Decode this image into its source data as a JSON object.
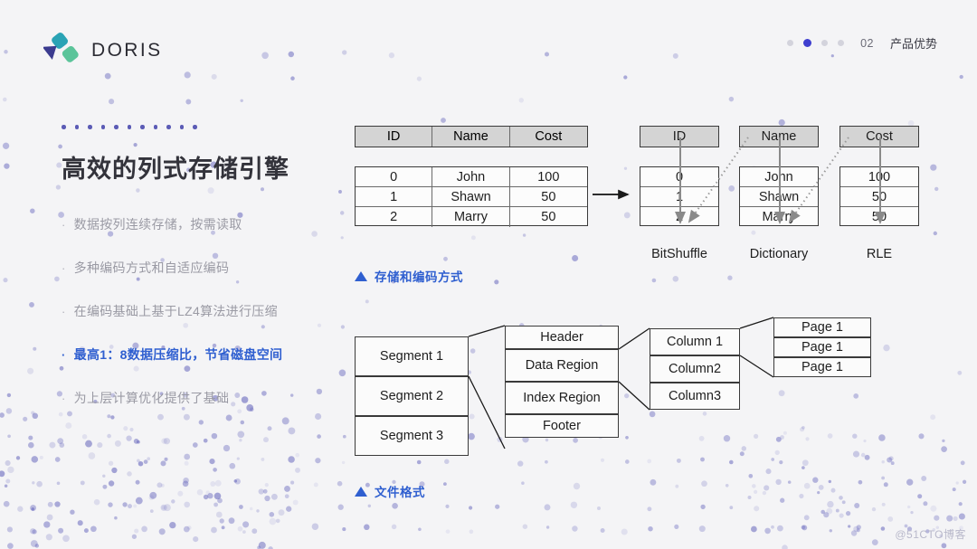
{
  "brand": {
    "name": "DORIS",
    "logo_icon": "doris-logo-icon",
    "logo_colors": {
      "triangle": "#3b3b8f",
      "teal": "#2aa3b5",
      "green": "#5bc49a"
    }
  },
  "nav": {
    "dots_total": 4,
    "active_index": 1,
    "number": "02",
    "label": "产品优势"
  },
  "left_panel": {
    "decor_dot_count": 11,
    "title": "高效的列式存储引擎",
    "bullets": [
      {
        "text": "数据按列连续存储，按需读取",
        "highlight": false
      },
      {
        "text": "多种编码方式和自适应编码",
        "highlight": false
      },
      {
        "text": "在编码基础上基于LZ4算法进行压缩",
        "highlight": false
      },
      {
        "text": "最高1：8数据压缩比，节省磁盘空间",
        "highlight": true
      },
      {
        "text": "为上层计算优化提供了基础",
        "highlight": false
      }
    ],
    "highlight_color": "#2f5fd0",
    "bullet_color": "#9a9aa4",
    "title_color": "#33333b"
  },
  "diagram_storage": {
    "caption": "存储和编码方式",
    "source_table": {
      "headers": [
        "ID",
        "Name",
        "Cost"
      ],
      "rows": [
        [
          "0",
          "John",
          "100"
        ],
        [
          "1",
          "Shawn",
          "50"
        ],
        [
          "2",
          "Marry",
          "50"
        ]
      ]
    },
    "columns": [
      {
        "header": "ID",
        "values": [
          "0",
          "1",
          "2"
        ],
        "encoding": "BitShuffle"
      },
      {
        "header": "Name",
        "values": [
          "John",
          "Shawn",
          "Marry"
        ],
        "encoding": "Dictionary"
      },
      {
        "header": "Cost",
        "values": [
          "100",
          "50",
          "50"
        ],
        "encoding": "RLE"
      }
    ],
    "arrow_icon": "right-arrow-icon"
  },
  "diagram_fileformat": {
    "caption": "文件格式",
    "segments": [
      "Segment 1",
      "Segment 2",
      "Segment 3"
    ],
    "segment_parts": [
      "Header",
      "Data Region",
      "Index Region",
      "Footer"
    ],
    "columns": [
      "Column 1",
      "Column2",
      "Column3"
    ],
    "pages": [
      "Page 1",
      "Page 1",
      "Page 1"
    ]
  },
  "watermark": "@51CTO博客",
  "background_color": "#f4f4f6"
}
